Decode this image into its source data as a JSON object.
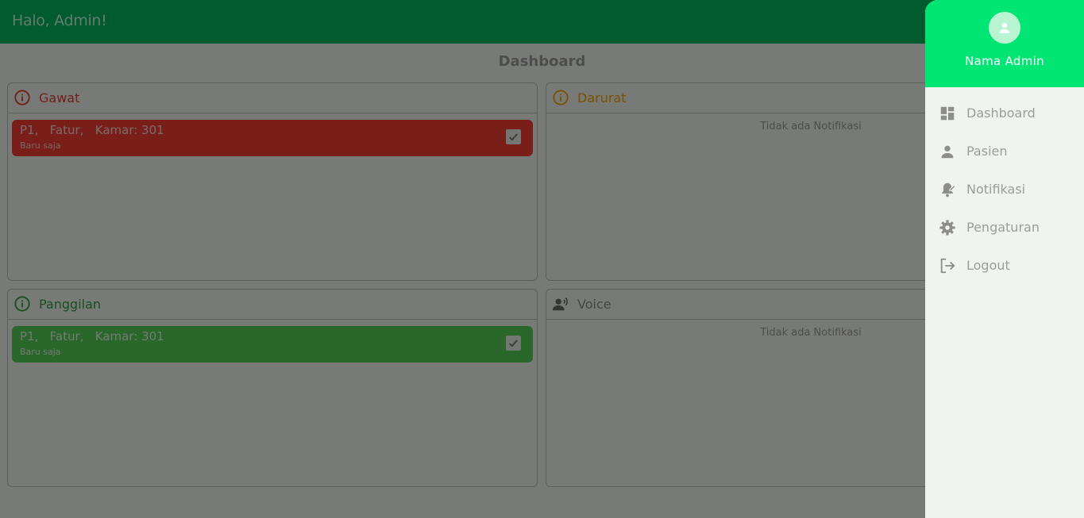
{
  "header": {
    "greeting": "Halo, Admin!"
  },
  "page": {
    "title": "Dashboard"
  },
  "panels": {
    "gawat": {
      "title": "Gawat",
      "icon": "info-circle-icon",
      "color": "#e33a30",
      "notification": {
        "patient": "P1,",
        "name": "Fatur,",
        "room": "Kamar: 301",
        "time": "Baru saja"
      }
    },
    "darurat": {
      "title": "Darurat",
      "icon": "info-circle-icon",
      "color": "#f2a300",
      "empty": "Tidak ada Notifikasi"
    },
    "panggilan": {
      "title": "Panggilan",
      "icon": "info-circle-icon",
      "color": "#2e9e3f",
      "notification": {
        "patient": "P1,",
        "name": "Fatur,",
        "room": "Kamar: 301",
        "time": "Baru saja"
      }
    },
    "voice": {
      "title": "Voice",
      "icon": "voice-person-icon",
      "empty": "Tidak ada Notifikasi"
    }
  },
  "drawer": {
    "name": "Nama Admin",
    "avatar_icon": "person-icon",
    "menu": [
      {
        "label": "Dashboard",
        "icon": "dashboard-icon"
      },
      {
        "label": "Pasien",
        "icon": "person-icon"
      },
      {
        "label": "Notifikasi",
        "icon": "notification-edit-icon"
      },
      {
        "label": "Pengaturan",
        "icon": "gear-icon"
      },
      {
        "label": "Logout",
        "icon": "logout-icon"
      }
    ]
  },
  "colors": {
    "appbar": "#00b85c",
    "drawer_header": "#00e574",
    "background": "#f1f4ee"
  }
}
